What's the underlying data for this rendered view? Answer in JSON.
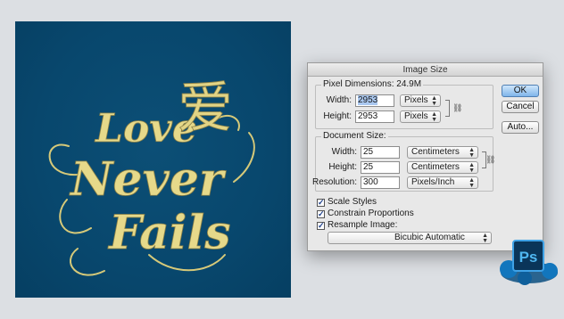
{
  "artwork": {
    "word_love": "Love",
    "word_never": "Never",
    "word_fails": "Fails",
    "hanzi": "爱"
  },
  "dialog": {
    "title": "Image Size",
    "pixel_dimensions": {
      "label": "Pixel Dimensions:",
      "size": "24.9M",
      "width_label": "Width:",
      "width_value": "2953",
      "width_unit": "Pixels",
      "height_label": "Height:",
      "height_value": "2953",
      "height_unit": "Pixels"
    },
    "document_size": {
      "label": "Document Size:",
      "width_label": "Width:",
      "width_value": "25",
      "width_unit": "Centimeters",
      "height_label": "Height:",
      "height_value": "25",
      "height_unit": "Centimeters",
      "resolution_label": "Resolution:",
      "resolution_value": "300",
      "resolution_unit": "Pixels/Inch"
    },
    "options": {
      "scale_styles": "Scale Styles",
      "constrain_proportions": "Constrain Proportions",
      "resample_image": "Resample Image:",
      "resample_method": "Bicubic Automatic"
    },
    "buttons": {
      "ok": "OK",
      "cancel": "Cancel",
      "auto": "Auto..."
    }
  },
  "icon": {
    "app_icon_label": "Ps",
    "colors": {
      "brand": "#0a4e7a",
      "ps_blue": "#1c8ad6"
    }
  }
}
